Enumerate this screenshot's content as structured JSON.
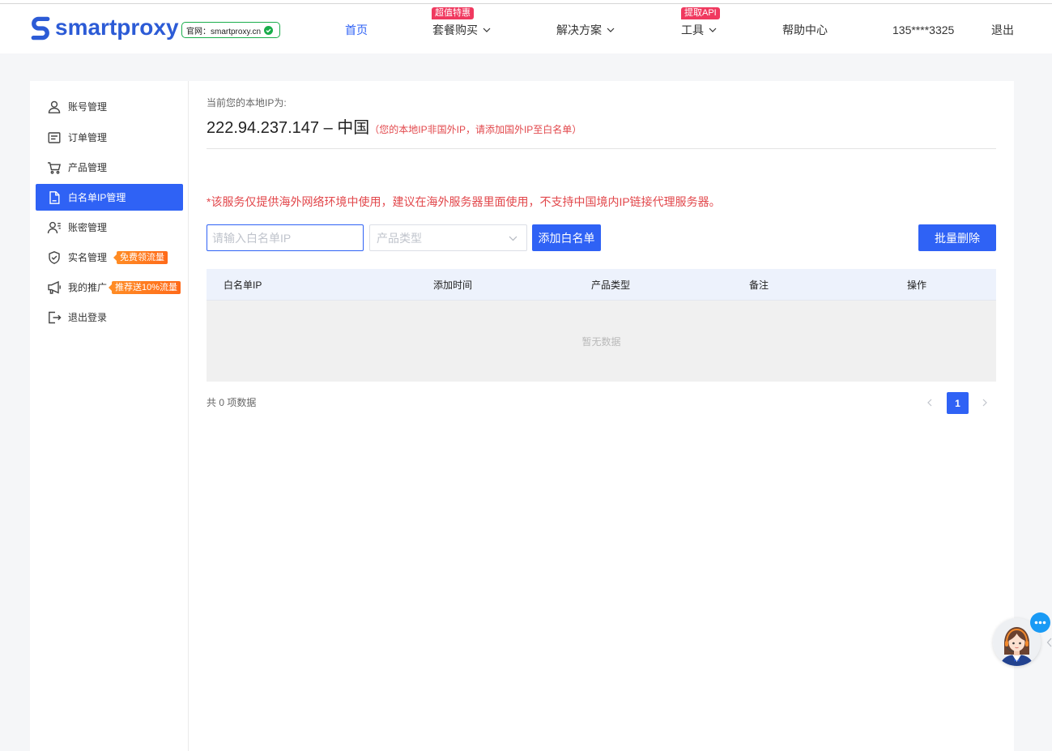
{
  "header": {
    "logo_text": "smartproxy",
    "logo_icon": "smartproxy-s-icon",
    "official_badge": "官网：smartproxy.cn",
    "official_badge_icon": "verified-check-icon",
    "nav": [
      {
        "label": "首页",
        "active": true
      },
      {
        "label": "套餐购买",
        "badge": "超值特惠",
        "dropdown": true
      },
      {
        "label": "解决方案",
        "dropdown": true
      },
      {
        "label": "工具",
        "badge": "提取API",
        "dropdown": true
      },
      {
        "label": "帮助中心"
      }
    ],
    "user_phone": "135****3325",
    "logout": "退出"
  },
  "sidebar": {
    "items": [
      {
        "label": "账号管理",
        "icon": "user-icon"
      },
      {
        "label": "订单管理",
        "icon": "order-icon"
      },
      {
        "label": "产品管理",
        "icon": "cart-icon"
      },
      {
        "label": "白名单IP管理",
        "icon": "document-icon",
        "active": true
      },
      {
        "label": "账密管理",
        "icon": "user-list-icon"
      },
      {
        "label": "实名管理",
        "icon": "shield-check-icon",
        "badge": "免费领流量"
      },
      {
        "label": "我的推广",
        "icon": "megaphone-icon",
        "badge": "推荐送10%流量"
      },
      {
        "label": "退出登录",
        "icon": "logout-icon"
      }
    ]
  },
  "main": {
    "ip_label": "当前您的本地IP为:",
    "ip_location": "222.94.237.147 – 中国",
    "ip_note": "（您的本地IP非国外IP，请添加国外IP至白名单）",
    "warning": "*该服务仅提供海外网络环境中使用，建议在海外服务器里面使用，不支持中国境内IP链接代理服务器。",
    "ip_input": {
      "value": "",
      "placeholder": "请输入白名单IP"
    },
    "product_select": {
      "placeholder": "产品类型"
    },
    "add_button": "添加白名单",
    "batch_delete_button": "批量删除",
    "table": {
      "columns": [
        "白名单IP",
        "添加时间",
        "产品类型",
        "备注",
        "操作"
      ],
      "rows": [],
      "empty_text": "暂无数据"
    },
    "total_text": "共 0 项数据",
    "pagination": {
      "current_page": "1",
      "prev_icon": "chevron-left-icon",
      "next_icon": "chevron-right-icon"
    }
  },
  "chat_widget": {
    "icon": "customer-service-avatar",
    "bubble_icon": "chat-bubble-icon"
  },
  "colors": {
    "primary": "#2f62f5",
    "danger": "#e2474b",
    "badge_red": "#f0395f",
    "badge_orange": "#ff6a1a",
    "success": "#1aad4b",
    "logo_blue": "#2c5bd6"
  }
}
